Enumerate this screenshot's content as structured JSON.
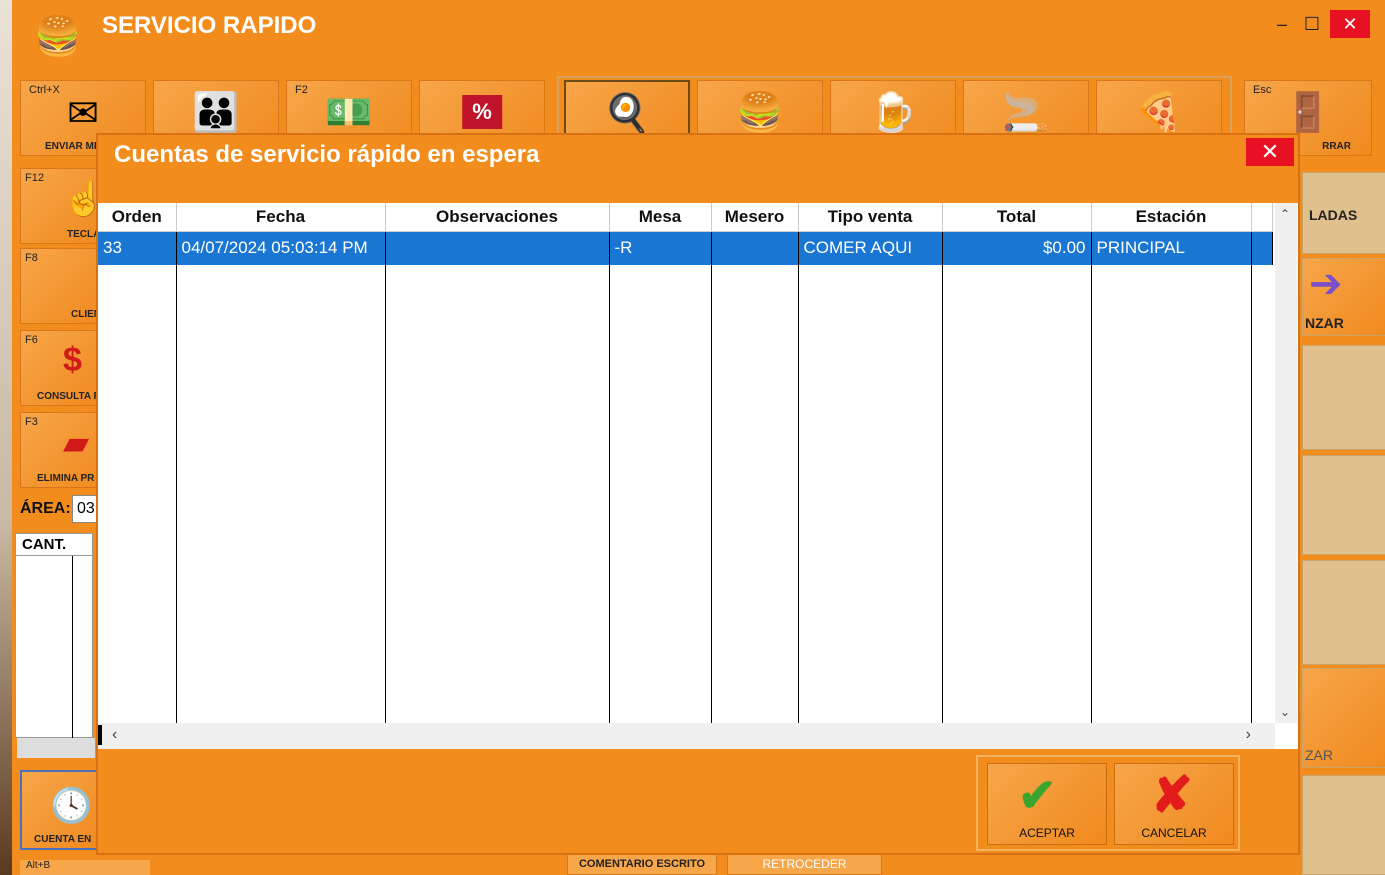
{
  "window": {
    "title": "SERVICIO RAPIDO",
    "minimize": "–",
    "maximize": "☐",
    "close": "✕"
  },
  "toolbar": [
    {
      "key": "Ctrl+X",
      "label": "ENVIAR ME",
      "icon": "envelope-icon",
      "glyph": "✉"
    },
    {
      "key": "",
      "label": "",
      "icon": "customers-icon",
      "glyph": "👪"
    },
    {
      "key": "F2",
      "label": "",
      "icon": "money-icon",
      "glyph": "💵"
    },
    {
      "key": "",
      "label": "",
      "icon": "discount-icon",
      "glyph": "%"
    },
    {
      "key": "",
      "label": "",
      "icon": "breakfast-icon",
      "glyph": "🍳"
    },
    {
      "key": "",
      "label": "",
      "icon": "burger-icon",
      "glyph": "🍔"
    },
    {
      "key": "",
      "label": "",
      "icon": "beer-icon",
      "glyph": "🍺"
    },
    {
      "key": "",
      "label": "",
      "icon": "cigarettes-icon",
      "glyph": "🚬"
    },
    {
      "key": "",
      "label": "",
      "icon": "pizza-icon",
      "glyph": "🍕"
    },
    {
      "key": "Esc",
      "label": "RRAR",
      "icon": "exit-door-icon",
      "glyph": "🚪"
    }
  ],
  "sidebar": [
    {
      "key": "F12",
      "label": "TECLA",
      "icon": "keypad-icon",
      "glyph": "☝"
    },
    {
      "key": "F8",
      "label": "CLIEN",
      "icon": "client-icon",
      "glyph": ""
    },
    {
      "key": "F6",
      "label": "CONSULTA P",
      "icon": "price-badge-icon",
      "glyph": "$"
    },
    {
      "key": "F3",
      "label": "ELIMINA PR",
      "icon": "eraser-icon",
      "glyph": "▰"
    }
  ],
  "area": {
    "label": "ÁREA:",
    "value": "03"
  },
  "cant_header": "CANT.",
  "right_panel": {
    "top_label": "LADAS",
    "advance_label": "NZAR",
    "back_label": "ZAR"
  },
  "bottom": {
    "cuenta_label": "CUENTA EN",
    "alt": "Alt+B",
    "comentario": "COMENTARIO ESCRITO",
    "retroceder": "RETROCEDER"
  },
  "dialog": {
    "title": "Cuentas de servicio rápido en espera",
    "close": "✕",
    "columns": [
      "Orden",
      "Fecha",
      "Observaciones",
      "Mesa",
      "Mesero",
      "Tipo venta",
      "Total",
      "Estación"
    ],
    "rows": [
      {
        "orden": "33",
        "fecha": "04/07/2024 05:03:14 PM",
        "observaciones": "",
        "mesa": "-R",
        "mesero": "",
        "tipo_venta": "COMER AQUI",
        "total": "$0.00",
        "estacion": "PRINCIPAL"
      }
    ],
    "accept_label": "ACEPTAR",
    "cancel_label": "CANCELAR"
  },
  "colors": {
    "orange": "#f28c1c",
    "selection": "#1976d2",
    "close_red": "#e81123"
  }
}
